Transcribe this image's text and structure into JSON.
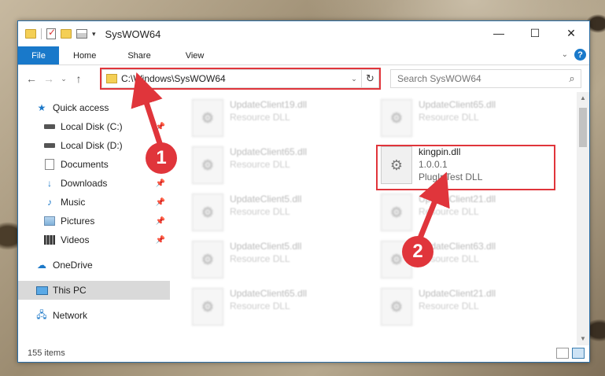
{
  "window": {
    "title": "SysWOW64",
    "controls": [
      "—",
      "☐",
      "✕"
    ]
  },
  "ribbon": {
    "file": "File",
    "tabs": [
      "Home",
      "Share",
      "View"
    ]
  },
  "address": {
    "path": "C:\\Windows\\SysWOW64",
    "search_placeholder": "Search SysWOW64"
  },
  "nav": {
    "quick_access": "Quick access",
    "items": [
      "Local Disk (C:)",
      "Local Disk (D:)",
      "Documents",
      "Downloads",
      "Music",
      "Pictures",
      "Videos"
    ],
    "onedrive": "OneDrive",
    "this_pc": "This PC",
    "network": "Network"
  },
  "files": [
    {
      "name": "UpdateClient19.dll",
      "type": "Resource DLL"
    },
    {
      "name": "UpdateClient65.dll",
      "type": "Resource DLL"
    },
    {
      "name": "UpdateClient65.dll",
      "type": "Resource DLL"
    },
    {
      "name": "kingpin.dll",
      "version": "1.0.0.1",
      "type": "PlugInTest DLL"
    },
    {
      "name": "UpdateClient5.dll",
      "type": "Resource DLL"
    },
    {
      "name": "UpdateClient21.dll",
      "type": "Resource DLL"
    },
    {
      "name": "UpdateClient5.dll",
      "type": "Resource DLL"
    },
    {
      "name": "UpdateClient63.dll",
      "type": "Resource DLL"
    },
    {
      "name": "UpdateClient65.dll",
      "type": "Resource DLL"
    },
    {
      "name": "UpdateClient21.dll",
      "type": "Resource DLL"
    }
  ],
  "status": {
    "count": "155 items"
  },
  "annotations": {
    "step1": "1",
    "step2": "2",
    "color": "#e0353b"
  }
}
